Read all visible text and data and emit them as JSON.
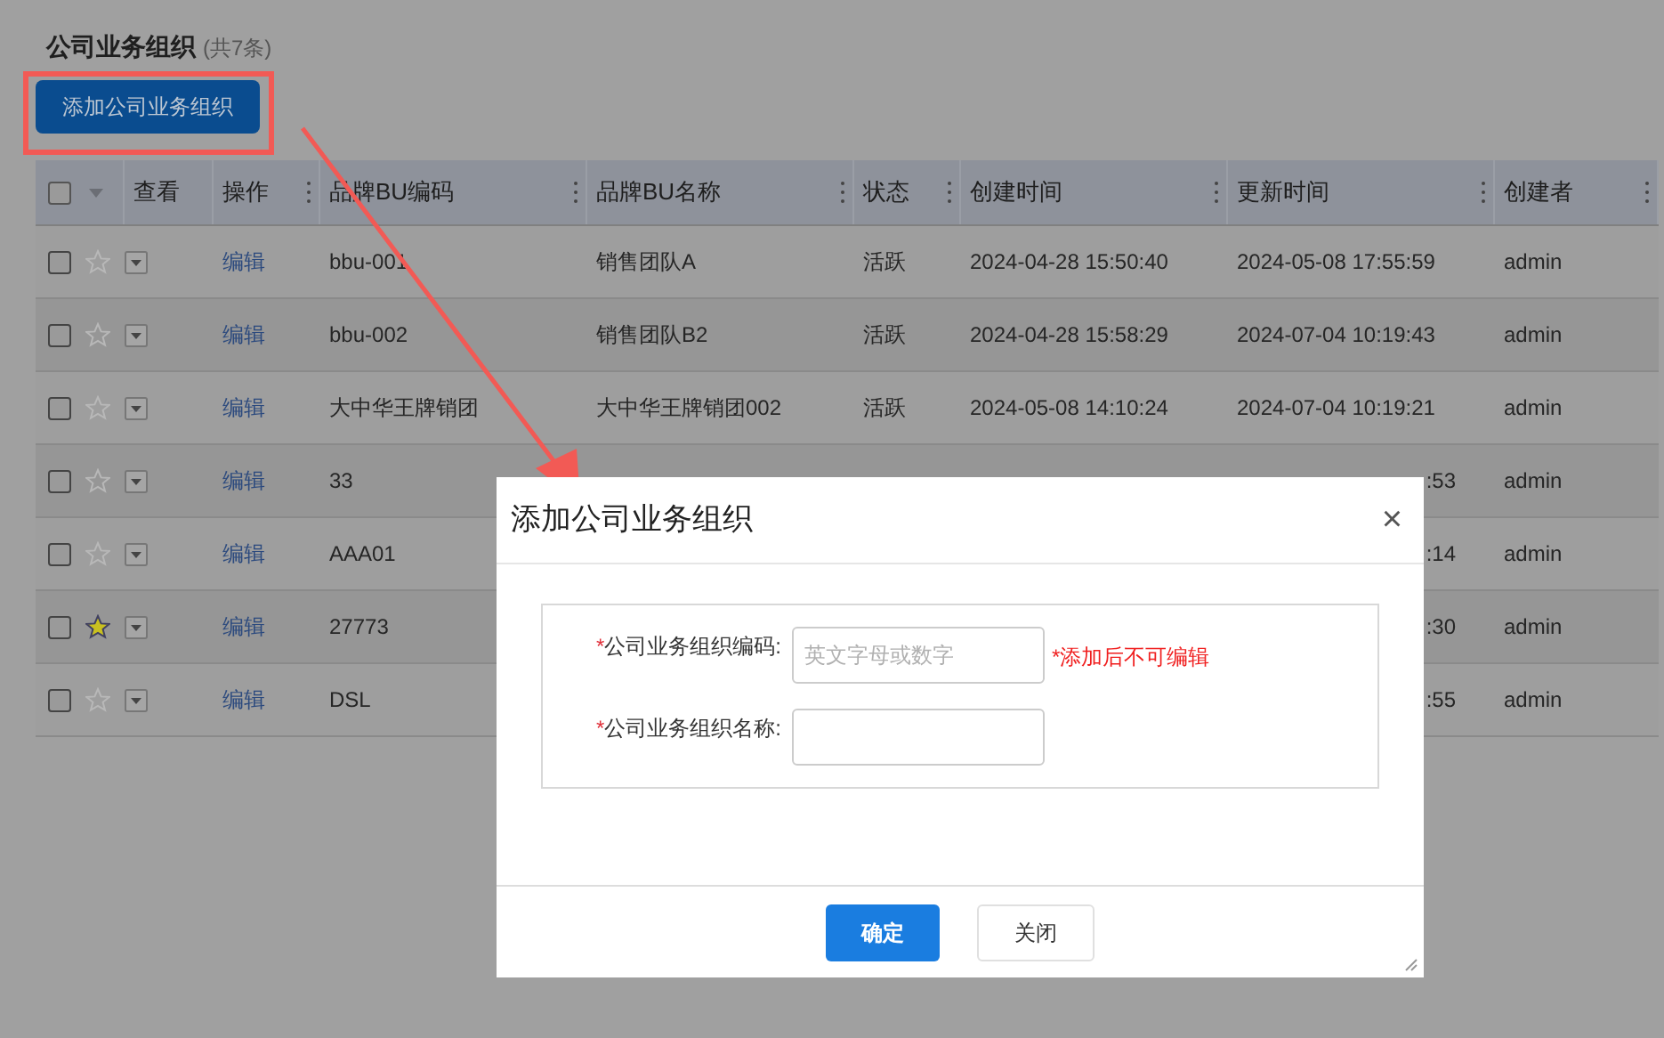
{
  "page": {
    "title": "公司业务组织",
    "count": "(共7条)",
    "add_button": "添加公司业务组织"
  },
  "table": {
    "select_all_checked": false,
    "columns": [
      "查看",
      "操作",
      "品牌BU编码",
      "品牌BU名称",
      "状态",
      "创建时间",
      "更新时间",
      "创建者"
    ],
    "rows": [
      {
        "checked": false,
        "starred": false,
        "action": "编辑",
        "code": "bbu-001",
        "name": "销售团队A",
        "status": "活跃",
        "created": "2024-04-28 15:50:40",
        "updated": "2024-05-08 17:55:59",
        "creator": "admin"
      },
      {
        "checked": false,
        "starred": false,
        "action": "编辑",
        "code": "bbu-002",
        "name": "销售团队B2",
        "status": "活跃",
        "created": "2024-04-28 15:58:29",
        "updated": "2024-07-04 10:19:43",
        "creator": "admin"
      },
      {
        "checked": false,
        "starred": false,
        "action": "编辑",
        "code": "大中华王牌销团",
        "name": "大中华王牌销团002",
        "status": "活跃",
        "created": "2024-05-08 14:10:24",
        "updated": "2024-07-04 10:19:21",
        "creator": "admin"
      },
      {
        "checked": false,
        "starred": false,
        "action": "编辑",
        "code": "33",
        "updated": ":53",
        "creator": "admin"
      },
      {
        "checked": false,
        "starred": false,
        "action": "编辑",
        "code": "AAA01",
        "updated": ":14",
        "creator": "admin"
      },
      {
        "checked": false,
        "starred": true,
        "action": "编辑",
        "code": "27773",
        "updated": ":30",
        "creator": "admin"
      },
      {
        "checked": false,
        "starred": false,
        "action": "编辑",
        "code": "DSL",
        "updated": ":55",
        "creator": "admin"
      }
    ]
  },
  "dialog": {
    "title": "添加公司业务组织",
    "close": "×",
    "fields": [
      {
        "required_mark": "*",
        "label": "公司业务组织编码:",
        "placeholder": "英文字母或数字",
        "hint": "*添加后不可编辑"
      },
      {
        "required_mark": "*",
        "label": "公司业务组织名称:"
      }
    ],
    "buttons": [
      {
        "kind": "primary",
        "label": "确定"
      },
      {
        "kind": "secondary",
        "label": "关闭"
      }
    ]
  }
}
